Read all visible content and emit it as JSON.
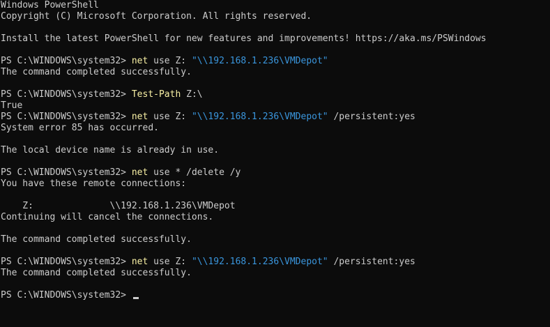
{
  "terminal": {
    "header_line1": "Windows PowerShell",
    "header_line2": "Copyright (C) Microsoft Corporation. All rights reserved.",
    "install_msg": "Install the latest PowerShell for new features and improvements! https://aka.ms/PSWindows",
    "prompt": "PS C:\\WINDOWS\\system32> ",
    "cmd1": {
      "name": "net",
      "args": " use Z: ",
      "path": "\"\\\\192.168.1.236\\VMDepot\""
    },
    "out1": "The command completed successfully.",
    "cmd2": {
      "name": "Test-Path",
      "args": " Z:\\"
    },
    "out2": "True",
    "cmd3": {
      "name": "net",
      "args": " use Z: ",
      "path": "\"\\\\192.168.1.236\\VMDepot\"",
      "tail": " /persistent:yes"
    },
    "out3a": "System error 85 has occurred.",
    "out3b": "The local device name is already in use.",
    "cmd4": {
      "name": "net",
      "args": " use * /delete /y"
    },
    "out4a": "You have these remote connections:",
    "out4b": "    Z:              \\\\192.168.1.236\\VMDepot",
    "out4c": "Continuing will cancel the connections.",
    "out4d": "The command completed successfully.",
    "cmd5": {
      "name": "net",
      "args": " use Z: ",
      "path": "\"\\\\192.168.1.236\\VMDepot\"",
      "tail": " /persistent:yes"
    },
    "out5": "The command completed successfully."
  },
  "colors": {
    "background": "#0c0c0c",
    "foreground": "#cccccc",
    "command": "#f9f1a5",
    "string": "#3a96dd"
  }
}
